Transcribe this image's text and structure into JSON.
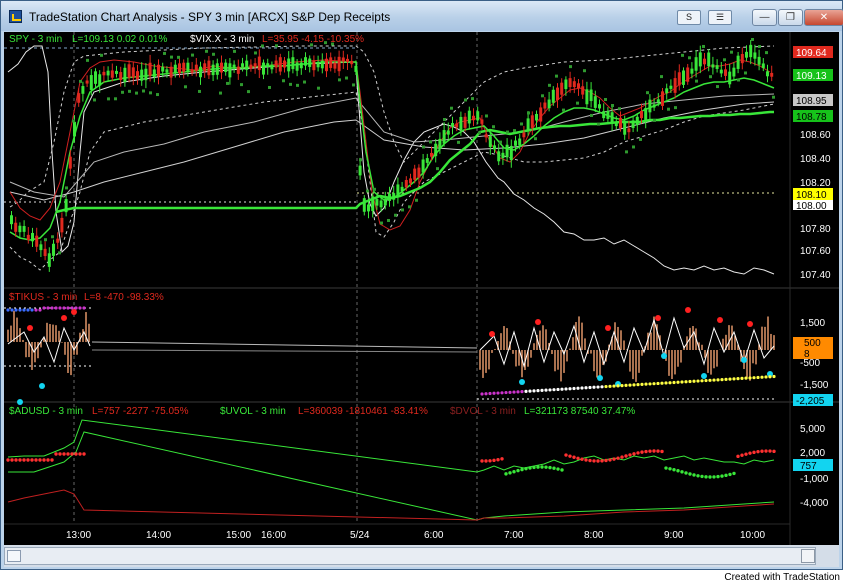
{
  "window": {
    "title": "TradeStation Chart Analysis - SPY 3 min [ARCX] S&P Dep Receipts",
    "s_button": "S",
    "format_button": "☰",
    "minimize": "—",
    "restore": "❐",
    "close": "✕"
  },
  "footer": {
    "credit": "Created with TradeStation"
  },
  "panes": {
    "price": {
      "label_spy": "SPY - 3 min",
      "label_spy_stats": "L=109.13  0.02  0.01%",
      "label_vix": "$VIX.X - 3 min",
      "label_vix_stats": "L=35.95  -4.15  -10.35%",
      "axis_ticks": [
        "108.60",
        "108.40",
        "108.20",
        "107.80",
        "107.60",
        "107.40"
      ],
      "markers": [
        {
          "text": "109.64",
          "color": "#e0291e",
          "textcolor": "#ffffff"
        },
        {
          "text": "109.13",
          "color": "#16c21a",
          "textcolor": "#ffffff"
        },
        {
          "text": "108.95",
          "color": "#c8c8c8",
          "textcolor": "#000000"
        },
        {
          "text": "108.78",
          "color": "#16c21a",
          "textcolor": "#000000"
        },
        {
          "text": "108.10",
          "color": "#ffff00",
          "textcolor": "#000000"
        },
        {
          "text": "108.00",
          "color": "#ffffff",
          "textcolor": "#000000"
        }
      ]
    },
    "tikus": {
      "label": "$TIKUS - 3 min",
      "stats": "L=8    -470    -98.33%",
      "axis_ticks": [
        "1,500",
        "-500",
        "-1,500"
      ],
      "markers": [
        {
          "text": "500",
          "color": "#ff8a00",
          "textcolor": "#000000"
        },
        {
          "text": "8",
          "color": "#ff8a00",
          "textcolor": "#000000"
        },
        {
          "text": "-2,205",
          "color": "#12d4f0",
          "textcolor": "#000000"
        }
      ]
    },
    "adusd": {
      "label_ad": "$ADUSD - 3 min",
      "label_ad_stats": "L=757    -2277    -75.05%",
      "label_uvol": "$UVOL - 3 min",
      "label_uvol_stats": "L=360039  -1810461  -83.41%",
      "label_dvol": "$DVOL - 3 min",
      "label_dvol_stats": "L=321173  87540   37.47%",
      "axis_ticks": [
        "5,000",
        "2,000",
        "-1,000",
        "-4,000"
      ],
      "markers": [
        {
          "text": "757",
          "color": "#12d4f0",
          "textcolor": "#000000"
        }
      ]
    }
  },
  "time_axis": [
    "13:00",
    "14:00",
    "15:00",
    "16:00",
    "5/24",
    "6:00",
    "7:00",
    "8:00",
    "9:00",
    "10:00"
  ]
}
